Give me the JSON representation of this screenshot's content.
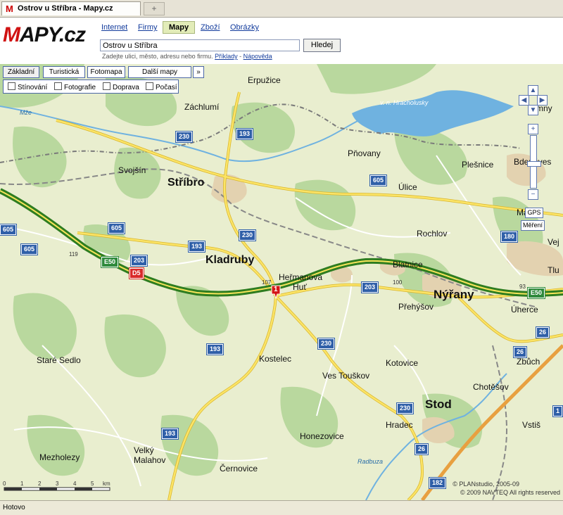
{
  "browser": {
    "tab_title": "Ostrov u Stříbra - Mapy.cz",
    "favicon": "M",
    "new_tab": "+",
    "status": "Hotovo"
  },
  "header": {
    "logo_m": "M",
    "logo_rest": "APY.cz",
    "nav": {
      "internet": "Internet",
      "firmy": "Firmy",
      "mapy": "Mapy",
      "zbozi": "Zboží",
      "obrazky": "Obrázky"
    },
    "search_value": "Ostrov u Stříbra",
    "search_button": "Hledej",
    "hint_text": "Zadejte ulici, město, adresu nebo firmu.",
    "hint_examples": "Příklady",
    "hint_sep": "-",
    "hint_help": "Nápověda"
  },
  "map_controls": {
    "types": {
      "zakladni": "Základní",
      "turisticka": "Turistická",
      "fotomapa": "Fotomapa",
      "dalsi": "Další mapy",
      "more": "»"
    },
    "layers": {
      "stinovani": "Stínování",
      "fotografie": "Fotografie",
      "doprava": "Doprava",
      "pocasi": "Počasí"
    },
    "gps": "GPS",
    "mereni": "Měření",
    "zoom_in": "+",
    "zoom_out": "−"
  },
  "places": {
    "erpuzice": "Erpužice",
    "zachlumi": "Záchlumí",
    "svojsin": "Svojšín",
    "stribro": "Stříbro",
    "kladruby": "Kladruby",
    "hermanova_hut_1": "Heřmanova",
    "hermanova_hut_2": "Huť",
    "pnovany": "Pňovany",
    "ulice": "Úlice",
    "plesnice": "Plešnice",
    "bdenes": "Bdeněves",
    "rochlov": "Rochlov",
    "blatnice": "Blatnice",
    "nyrany": "Nýřany",
    "prehysov": "Přehýšov",
    "uherce": "Úherce",
    "stare_sedlo": "Staré Sedlo",
    "kostelec": "Kostelec",
    "ves_touskov": "Ves Touškov",
    "kotovice": "Kotovice",
    "zbuch": "Zbůch",
    "chotesov": "Chotěšov",
    "stod": "Stod",
    "hradec": "Hradec",
    "vstis": "Vstiš",
    "honezovice": "Honezovice",
    "velky_malahov_1": "Velký",
    "velky_malahov_2": "Malahov",
    "mezholezy": "Mezholezy",
    "cernovice": "Černovice",
    "mze": "Mže",
    "radbuza": "Radbuza",
    "v_n_hracholusky": "v. n. Hracholusky",
    "tlu": "Tlu",
    "vej": "Vej",
    "ma": "Ma",
    "mny": "mny"
  },
  "roads": {
    "r230": "230",
    "r193": "193",
    "r605": "605",
    "r203": "203",
    "d5": "D5",
    "e50": "E50",
    "r180": "180",
    "r26": "26",
    "r182": "182",
    "r107": "107",
    "r100": "100",
    "r119": "119",
    "r93": "93",
    "r1": "1"
  },
  "marker": "1",
  "scale": {
    "ticks": [
      "0",
      "1",
      "2",
      "3",
      "4",
      "5"
    ],
    "unit": "km"
  },
  "copyright": {
    "line1": "© PLANstudio, 2005-09",
    "line2": "© 2009 NAVTEQ All rights reserved"
  },
  "colors": {
    "motorway": "#3a9a2a",
    "main_road": "#f2d33b",
    "water": "#6fb2e0",
    "forest": "#a9cf8f",
    "rail": "#808080",
    "border": "#666666"
  }
}
